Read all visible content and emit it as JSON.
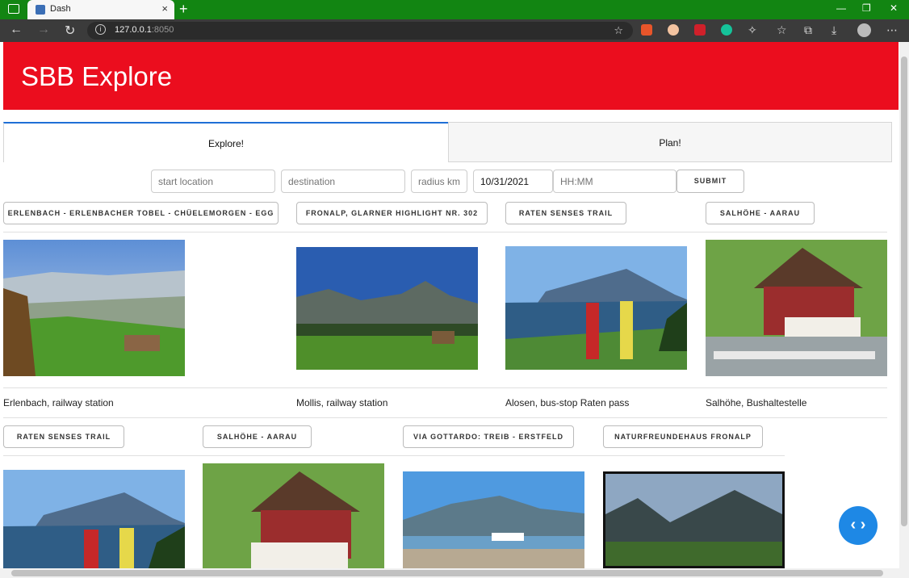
{
  "browser": {
    "tab_title": "Dash",
    "tab_close": "×",
    "new_tab": "+",
    "url_host": "127.0.0.1",
    "url_port": ":8050",
    "back": "←",
    "forward": "→",
    "reload": "↻",
    "win_minimize": "—",
    "win_maximize": "❐",
    "win_close": "✕",
    "menu": "⋯"
  },
  "header": {
    "title": "SBB Explore"
  },
  "tabs": [
    {
      "label": "Explore!"
    },
    {
      "label": "Plan!"
    }
  ],
  "form": {
    "start_placeholder": "start location",
    "destination_placeholder": "destination",
    "radius_placeholder": "radius km",
    "date_value": "10/31/2021",
    "time_placeholder": "HH:MM",
    "submit_label": "SUBMIT"
  },
  "row1": {
    "routes": [
      "ERLENBACH - ERLENBACHER TOBEL - CHÜELEMORGEN - EGG",
      "FRONALP, GLARNER HIGHLIGHT NR. 302",
      "RATEN SENSES TRAIL",
      "SALHÖHE - AARAU"
    ],
    "captions": [
      "Erlenbach, railway station",
      "Mollis, railway station",
      "Alosen, bus-stop Raten pass",
      "Salhöhe, Bushaltestelle"
    ]
  },
  "row2": {
    "routes": [
      "RATEN SENSES TRAIL",
      "SALHÖHE - AARAU",
      "VIA GOTTARDO: TREIB - ERSTFELD",
      "NATURFREUNDEHAUS FRONALP"
    ]
  },
  "fab": {
    "label": "‹ ›"
  },
  "colors": {
    "brand": "#eb0d1e",
    "tab_accent": "#1f6fd6",
    "fab": "#1e88e5"
  }
}
